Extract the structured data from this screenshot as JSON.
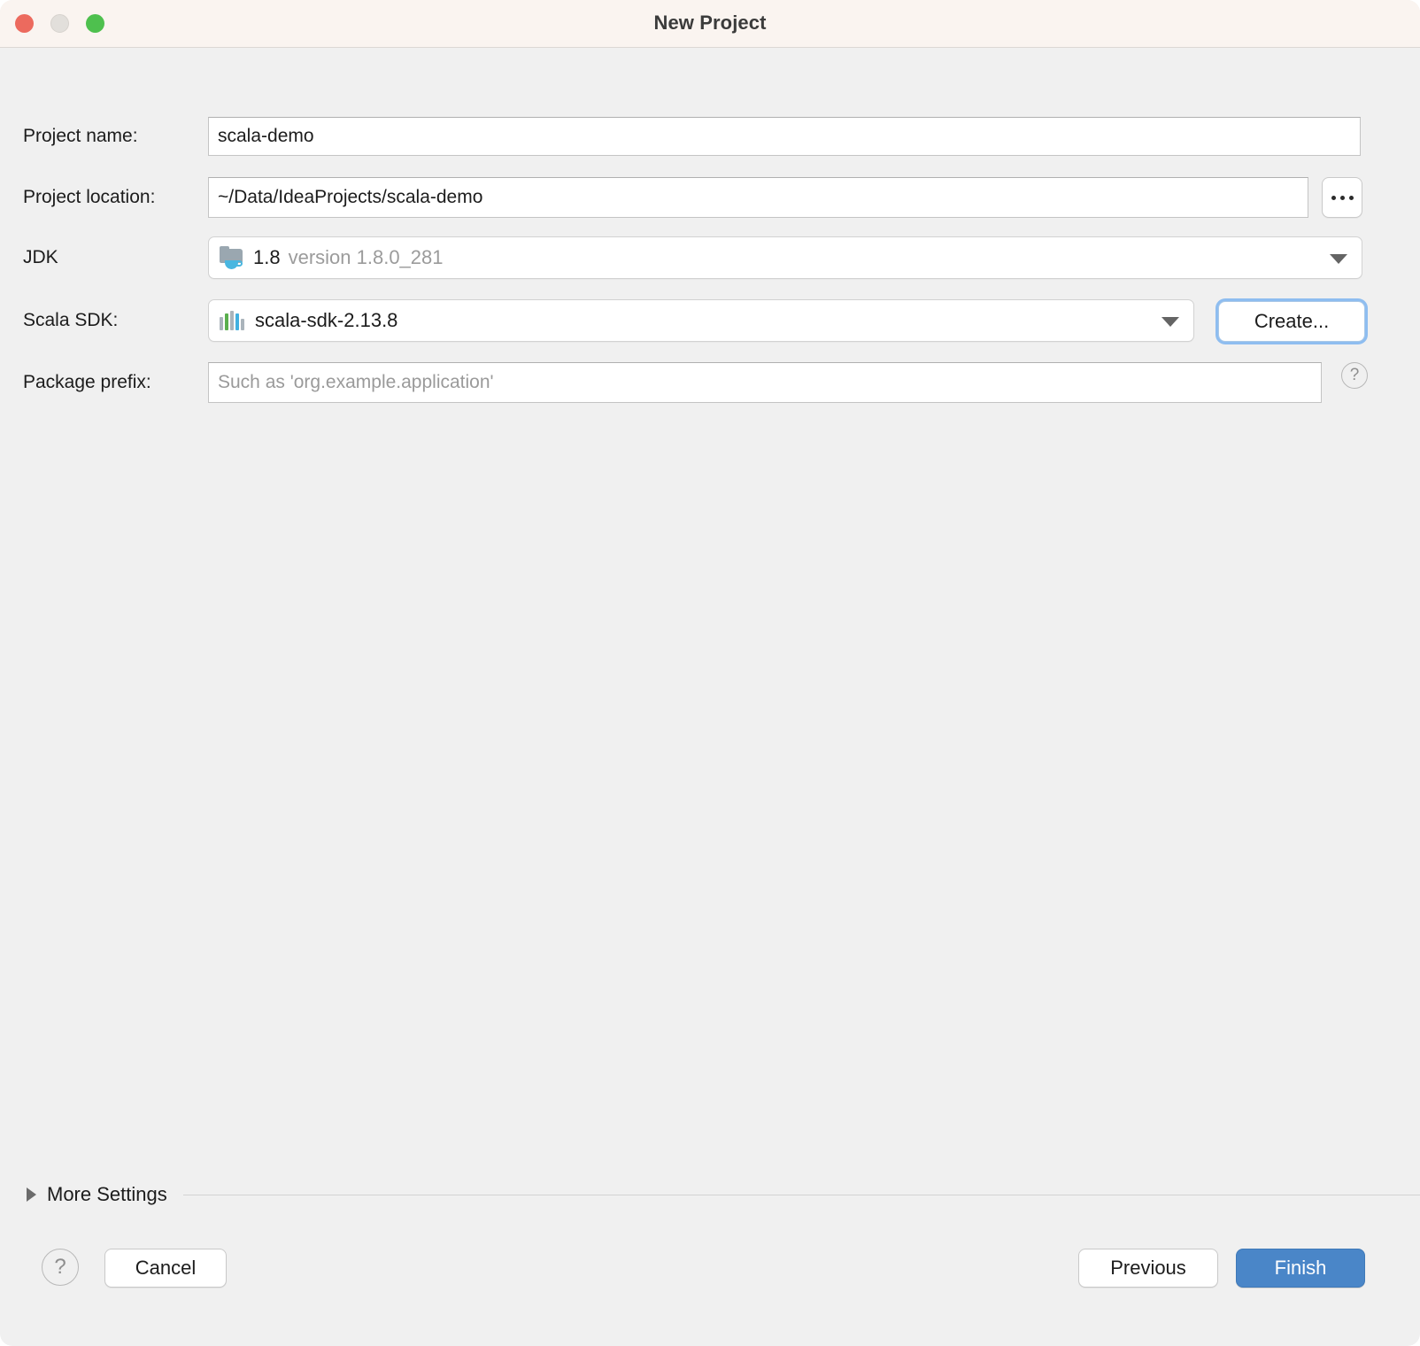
{
  "window": {
    "title": "New Project",
    "traffic_lights": [
      "close-button",
      "minimize-button",
      "zoom-button"
    ]
  },
  "form": {
    "project_name": {
      "label": "Project name:",
      "value": "scala-demo"
    },
    "project_location": {
      "label": "Project location:",
      "value": "~/Data/IdeaProjects/scala-demo",
      "browse_label": "..."
    },
    "jdk": {
      "label": "JDK",
      "value": "1.8",
      "value_detail": "version 1.8.0_281",
      "icon": "jdk-folder-icon"
    },
    "scala_sdk": {
      "label": "Scala SDK:",
      "value": "scala-sdk-2.13.8",
      "icon": "scala-bars-icon",
      "create_label": "Create..."
    },
    "package_prefix": {
      "label": "Package prefix:",
      "value": "",
      "placeholder": "Such as 'org.example.application'",
      "help_label": "?"
    }
  },
  "more_settings": {
    "label": "More Settings",
    "expanded": false
  },
  "footer": {
    "help_label": "?",
    "cancel_label": "Cancel",
    "previous_label": "Previous",
    "finish_label": "Finish"
  },
  "colors": {
    "accent": "#4a86c8",
    "focus_ring": "#8ebdf0",
    "titlebar_bg": "#faf4f0",
    "dialog_bg": "#f0f0f0",
    "close_light": "#ec6a5e",
    "min_light": "#e2dfdb",
    "max_light": "#4ec04e",
    "scala_bars": [
      "#aab4bb",
      "#5aaf4d",
      "#aab4bb",
      "#41b0e0",
      "#aab4bb"
    ]
  }
}
